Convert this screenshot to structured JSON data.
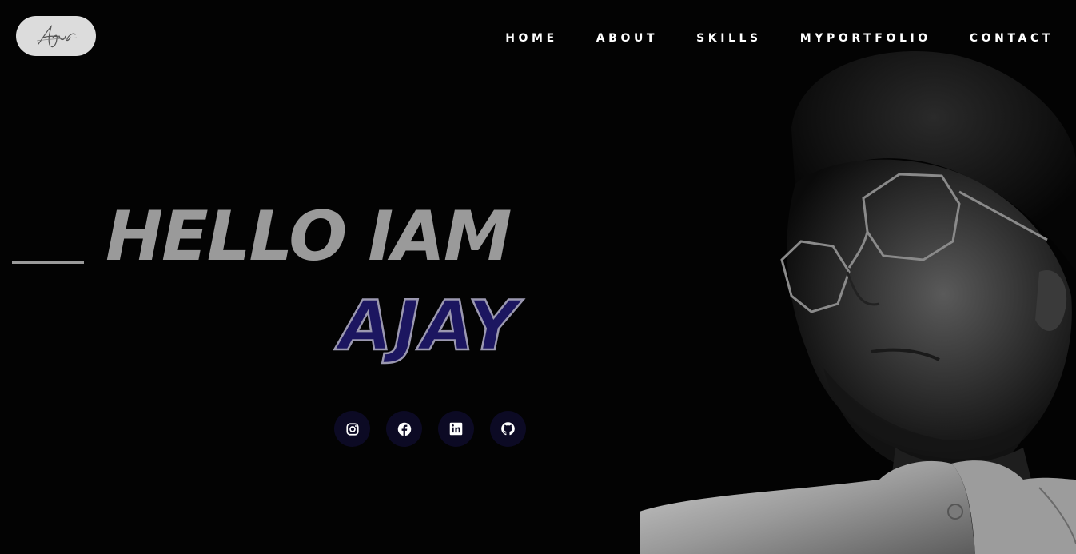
{
  "logo": {
    "text": "Ajay",
    "background": "#dcdcdc"
  },
  "nav": {
    "items": [
      {
        "label": "HOME"
      },
      {
        "label": "ABOUT"
      },
      {
        "label": "SKILLS"
      },
      {
        "label": "MYPORTFOLIO"
      },
      {
        "label": "CONTACT"
      }
    ]
  },
  "hero": {
    "greeting": "HELLO IAM",
    "name": "AJAY",
    "greeting_color": "#9a9a9a",
    "name_fill": "#1c1660",
    "name_outline": "#9b98b0"
  },
  "social": {
    "links": [
      {
        "icon": "instagram-icon"
      },
      {
        "icon": "facebook-icon"
      },
      {
        "icon": "linkedin-icon"
      },
      {
        "icon": "github-icon"
      }
    ],
    "button_color": "#0c0a24"
  },
  "colors": {
    "background": "#030303",
    "nav_text": "#ffffff"
  }
}
